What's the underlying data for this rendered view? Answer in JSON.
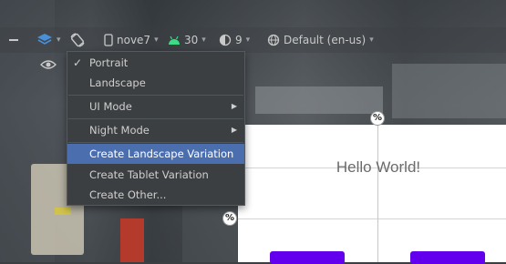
{
  "toolbar": {
    "device": "nove7",
    "api": "30",
    "theme": "9",
    "locale": "Default (en-us)"
  },
  "menu": {
    "items": [
      {
        "label": "Portrait",
        "checked": true
      },
      {
        "label": "Landscape"
      },
      {
        "label": "UI Mode",
        "submenu": true
      },
      {
        "label": "Night Mode",
        "submenu": true
      },
      {
        "label": "Create Landscape Variation",
        "selected": true
      },
      {
        "label": "Create Tablet Variation"
      },
      {
        "label": "Create Other..."
      }
    ]
  },
  "preview": {
    "hello_text": "Hello World!",
    "constraint_marker": "%",
    "button_color": "#6200ee"
  },
  "colors": {
    "menu_bg": "#3c3f41",
    "selection": "#4b6eaf",
    "android_green": "#3ddc84"
  }
}
